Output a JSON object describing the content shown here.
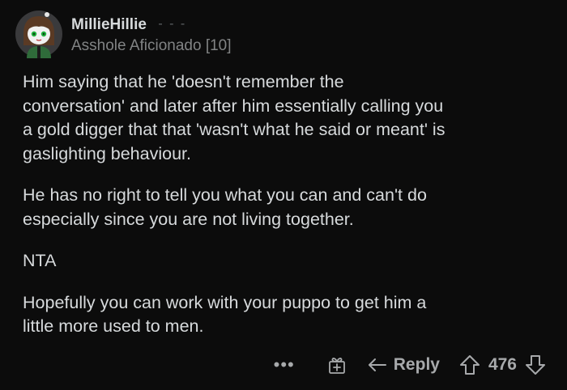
{
  "author": {
    "username": "MillieHillie",
    "flair": "Asshole Aficionado [10]"
  },
  "comment": {
    "paragraphs": [
      "Him saying that he 'doesn't remember the\nconversation' and later after him essentially calling you\na gold digger that that 'wasn't what he said or meant' is\ngaslighting behaviour.",
      "He has no right to tell you what you can and can't do\nespecially since you are not living together.",
      "NTA",
      "Hopefully you can work with your puppo to get him a\nlittle more used to men."
    ]
  },
  "actions": {
    "more_label": "•••",
    "reply_label": "Reply",
    "score": "476"
  }
}
